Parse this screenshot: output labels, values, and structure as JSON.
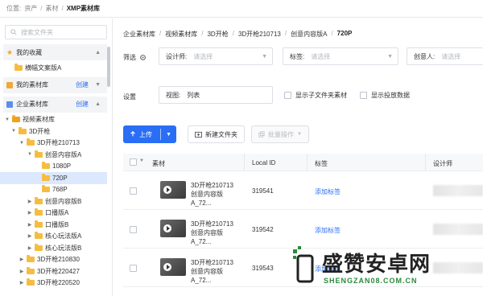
{
  "topbar": {
    "location_label": "位置:",
    "path": [
      "资产",
      "素材"
    ],
    "current": "XMP素材库"
  },
  "sidebar": {
    "search_placeholder": "搜索文件夹",
    "favorites": {
      "title": "我的收藏",
      "items": [
        "横幅文案版A"
      ]
    },
    "my_library": {
      "title": "我的素材库",
      "action": "创建"
    },
    "enterprise_library": {
      "title": "企业素材库",
      "action": "创建"
    },
    "tree": [
      {
        "label": "视频素材库",
        "level": 0,
        "expanded": true,
        "icon": "lock-folder-icon"
      },
      {
        "label": "3D开枪",
        "level": 1,
        "expanded": true
      },
      {
        "label": "3D开枪210713",
        "level": 2,
        "expanded": true
      },
      {
        "label": "创意内容版A",
        "level": 3,
        "expanded": true
      },
      {
        "label": "1080P",
        "level": 4
      },
      {
        "label": "720P",
        "level": 4,
        "selected": true
      },
      {
        "label": "768P",
        "level": 4
      },
      {
        "label": "创意内容版B",
        "level": 3
      },
      {
        "label": "口播版A",
        "level": 3
      },
      {
        "label": "口播版B",
        "level": 3
      },
      {
        "label": "核心玩法版A",
        "level": 3
      },
      {
        "label": "核心玩法版B",
        "level": 3
      },
      {
        "label": "3D开枪210830",
        "level": 2
      },
      {
        "label": "3D开枪220427",
        "level": 2
      },
      {
        "label": "3D开枪220520",
        "level": 2
      }
    ]
  },
  "breadcrumb": [
    "企业素材库",
    "视频素材库",
    "3D开枪",
    "3D开枪210713",
    "创意内容版A",
    "720P"
  ],
  "filter": {
    "label": "筛选",
    "designer": {
      "label": "设计师:",
      "placeholder": "请选择"
    },
    "tags": {
      "label": "标签:",
      "placeholder": "请选择"
    },
    "creator": {
      "label": "创意人:",
      "placeholder": "请选择"
    }
  },
  "settings": {
    "label": "设置",
    "view": {
      "label": "视图:",
      "value": "列表"
    },
    "show_subfolder": "显示子文件夹素材",
    "show_delivery": "显示投放数据"
  },
  "toolbar": {
    "upload": "上传",
    "new_folder": "新建文件夹",
    "batch": "批量操作"
  },
  "table": {
    "columns": [
      "素材",
      "Local ID",
      "标签",
      "设计师"
    ],
    "rows": [
      {
        "name": "3D开枪210713创意内容版A_72...",
        "local_id": "319541",
        "tag_action": "添加标签"
      },
      {
        "name": "3D开枪210713创意内容版A_72...",
        "local_id": "319542",
        "tag_action": "添加标签"
      },
      {
        "name": "3D开枪210713创意内容版A_72...",
        "local_id": "319543",
        "tag_action": "添加标签"
      }
    ]
  },
  "watermark": {
    "title": "盛赞安卓网",
    "subtitle": "SHENGZAN08.COM.CN"
  },
  "colors": {
    "accent": "#2a6ef5",
    "folder": "#f5bd40",
    "selected_bg": "#dbe8fd"
  }
}
